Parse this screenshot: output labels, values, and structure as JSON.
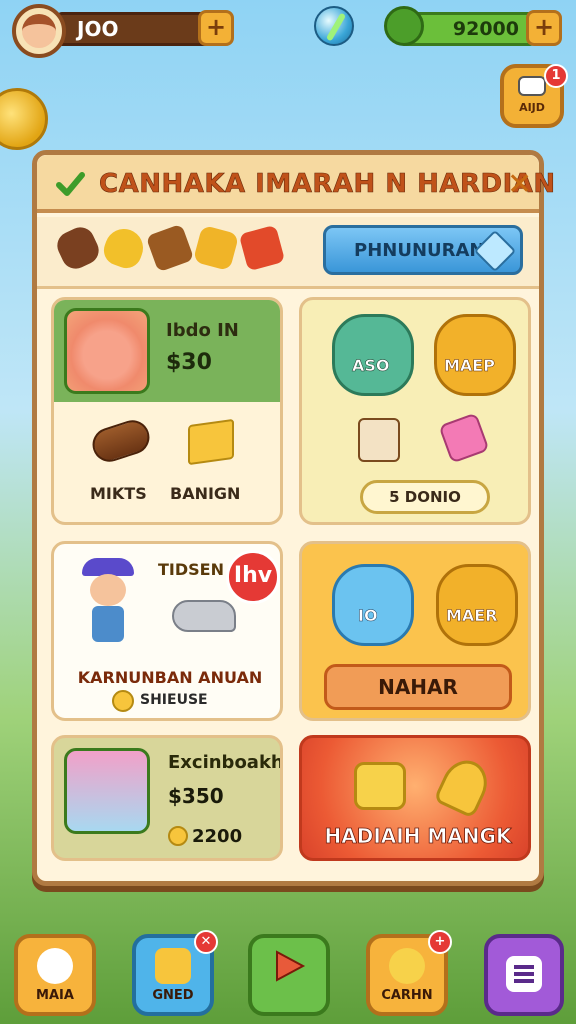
{
  "top_bar": {
    "coins": "JOO",
    "cash": "92000",
    "coin_add": "+",
    "cash_add": "+",
    "mail_label": "AIJD",
    "mail_badge": "1"
  },
  "panel": {
    "title": "CANHAKA IMARAH N HARDIAN",
    "close": "✕",
    "search_label": "PHNUNURAN",
    "resources": [
      "log",
      "corn",
      "plank",
      "pineapple",
      "strawberry"
    ]
  },
  "cards": {
    "c1": {
      "name": "Ibdo IN",
      "price": "$30",
      "item1": "MIKTS",
      "item2": "BANIGN"
    },
    "c2": {
      "blob1": "ASO",
      "blob2": "MAEP",
      "pill": "5 DONIO"
    },
    "c3": {
      "tag": "TIDSEN",
      "live": "Ihv",
      "line1": "KARNUNBAN ANUAN",
      "line2": "SHIEUSE"
    },
    "c4": {
      "blob1": "IO",
      "blob2": "MAER",
      "button": "NAHAR"
    },
    "c5": {
      "name": "Excinboakh",
      "price": "$350",
      "coins": "2200"
    },
    "c6": {
      "label": "HADIAIH MANGK"
    }
  },
  "bottom_nav": [
    {
      "label": "MAIA"
    },
    {
      "label": "GNED",
      "badge": "✕"
    },
    {
      "label": ""
    },
    {
      "label": "CARHN",
      "badge": "+"
    },
    {
      "label": ""
    }
  ],
  "colors": {
    "panel_bg": "#fff4dc",
    "title_color": "#c0521a",
    "accent_green": "#7ab35a",
    "accent_orange": "#f3b136"
  }
}
